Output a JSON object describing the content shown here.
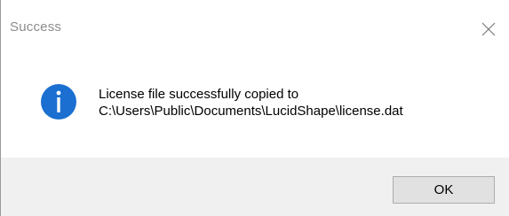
{
  "window": {
    "title": "Success",
    "close_icon": "close-icon"
  },
  "message": {
    "icon": "info-icon",
    "icon_color": "#1a6fd1",
    "line1": "License file successfully copied to",
    "line2": "C:\\Users\\Public\\Documents\\LucidShape\\license.dat"
  },
  "buttons": {
    "ok_label": "OK"
  }
}
